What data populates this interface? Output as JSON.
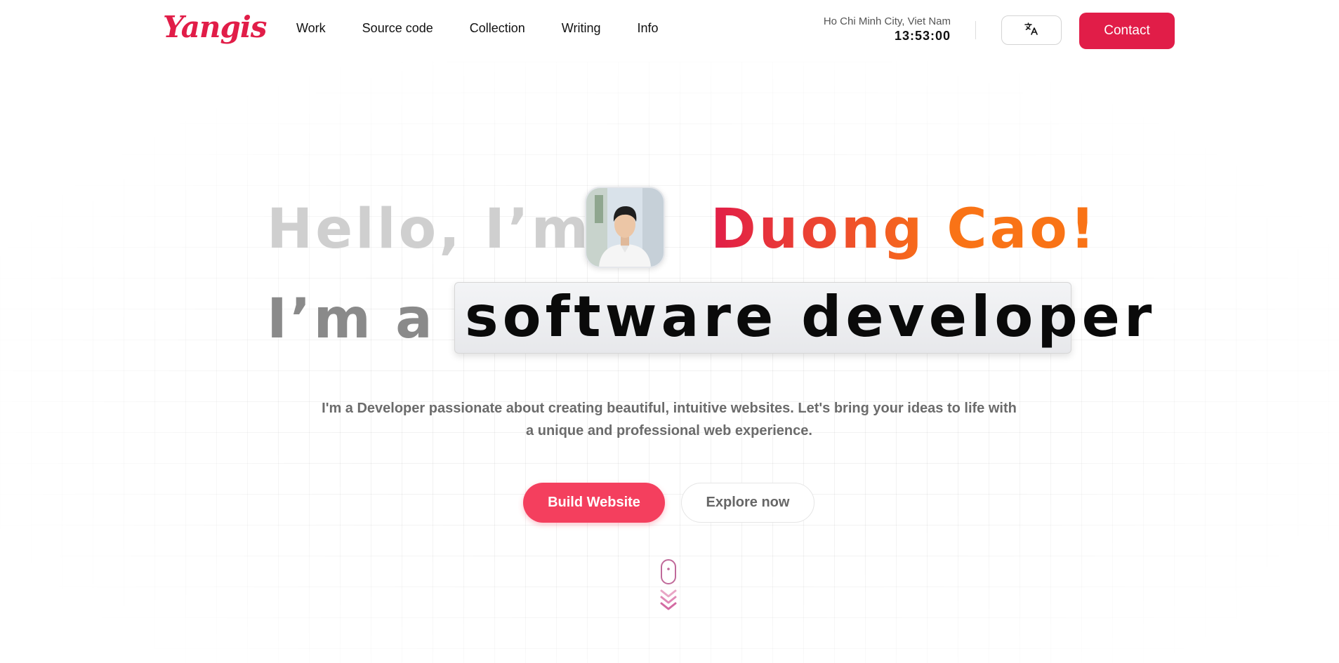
{
  "header": {
    "logo": "Yangis",
    "nav": [
      "Work",
      "Source code",
      "Collection",
      "Writing",
      "Info"
    ],
    "location": "Ho Chi Minh City, Viet Nam",
    "time": "13:53:00",
    "language_icon": "translate-icon",
    "contact_label": "Contact"
  },
  "hero": {
    "greeting": "Hello, I’m",
    "name": "Duong Cao!",
    "role_prefix": "I’m a",
    "role": "software developer",
    "description": "I'm a Developer passionate about creating beautiful, intuitive websites. Let's bring your ideas to life with a unique and professional web experience.",
    "primary_cta": "Build Website",
    "secondary_cta": "Explore now"
  },
  "colors": {
    "accent": "#e11d48",
    "accent_light": "#f43f5e",
    "name_gradient_end": "#f97316",
    "muted_text": "#6b6b6b"
  }
}
